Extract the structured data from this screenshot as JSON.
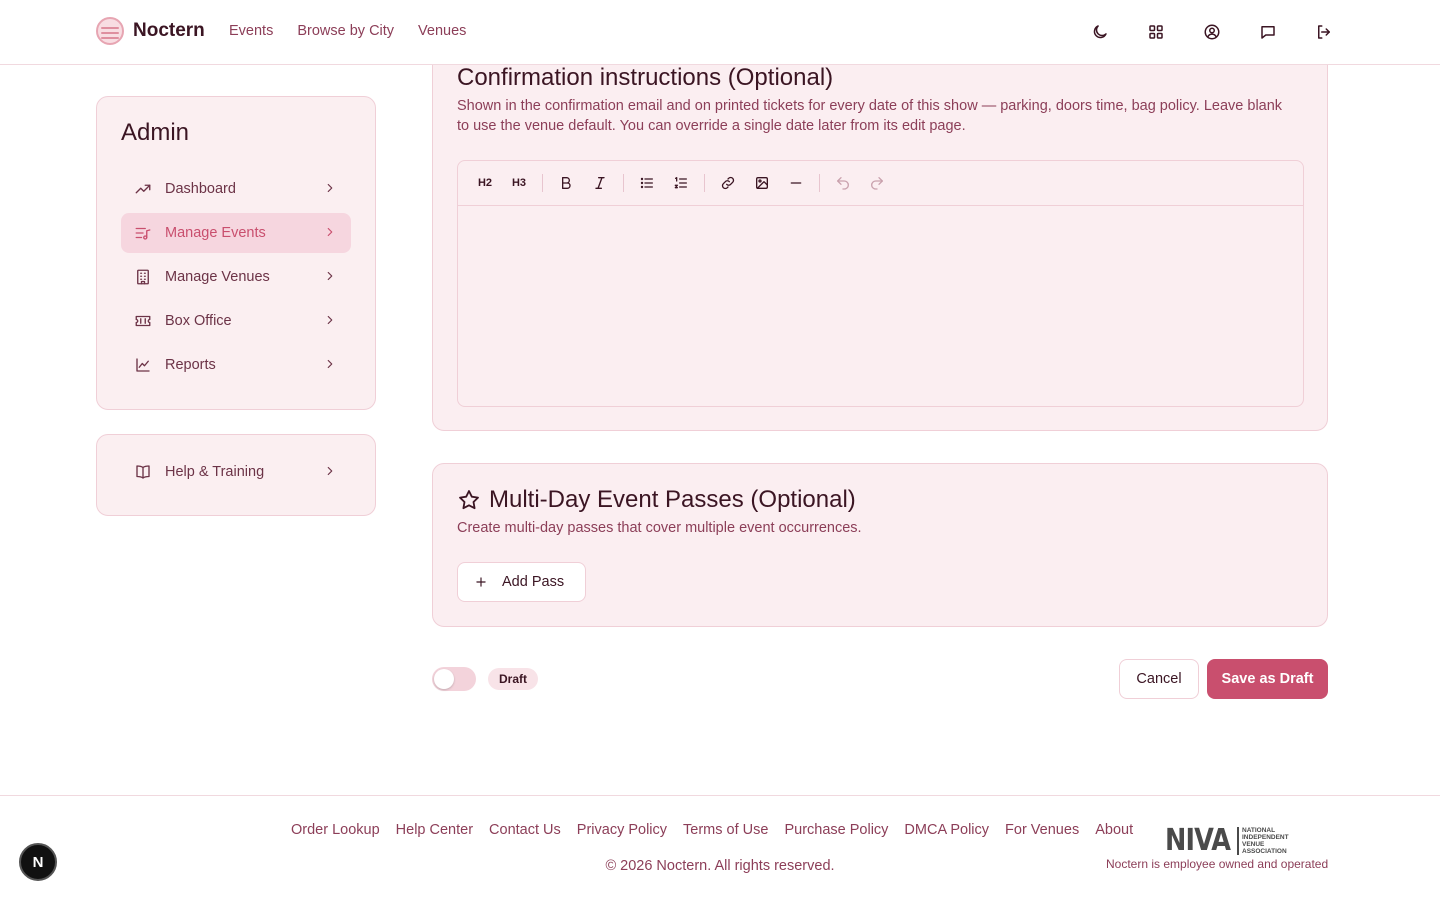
{
  "app": {
    "name": "Noctern"
  },
  "nav": {
    "items": [
      "Events",
      "Browse by City",
      "Venues"
    ]
  },
  "header_icons": [
    "moon-icon",
    "grid-icon",
    "user-circle-icon",
    "message-icon",
    "logout-icon"
  ],
  "sidebar": {
    "title": "Admin",
    "items": [
      {
        "label": "Dashboard",
        "icon": "trending-up-icon",
        "active": false
      },
      {
        "label": "Manage Events",
        "icon": "list-music-icon",
        "active": true
      },
      {
        "label": "Manage Venues",
        "icon": "building-icon",
        "active": false
      },
      {
        "label": "Box Office",
        "icon": "ticket-icon",
        "active": false
      },
      {
        "label": "Reports",
        "icon": "line-chart-icon",
        "active": false
      }
    ],
    "help": {
      "label": "Help & Training",
      "icon": "book-icon"
    }
  },
  "confirmation": {
    "title": "Confirmation instructions (Optional)",
    "description": "Shown in the confirmation email and on printed tickets for every date of this show — parking, doors time, bag policy. Leave blank to use the venue default. You can override a single date later from its edit page.",
    "toolbar": {
      "h2": "H2",
      "h3": "H3"
    },
    "content": ""
  },
  "passes": {
    "title": "Multi-Day Event Passes (Optional)",
    "description": "Create multi-day passes that cover multiple event occurrences.",
    "add_label": "Add Pass"
  },
  "actions": {
    "status_badge": "Draft",
    "publish_toggle_on": false,
    "cancel_label": "Cancel",
    "save_label": "Save as Draft"
  },
  "footer": {
    "links": [
      "Order Lookup",
      "Help Center",
      "Contact Us",
      "Privacy Policy",
      "Terms of Use",
      "Purchase Policy",
      "DMCA Policy",
      "For Venues",
      "About"
    ],
    "copyright": "© 2026 Noctern. All rights reserved.",
    "niva_logo": {
      "big": "NIVA",
      "small": [
        "NATIONAL",
        "INDEPENDENT",
        "VENUE",
        "ASSOCIATION"
      ]
    },
    "tagline": "Noctern is employee owned and operated"
  },
  "fab": {
    "label": "N"
  },
  "colors": {
    "accent": "#c94f6e",
    "card_bg": "#fbeef1",
    "border": "#f0cfd7",
    "text_dark": "#3b1523",
    "text_muted": "#8c3e58"
  }
}
